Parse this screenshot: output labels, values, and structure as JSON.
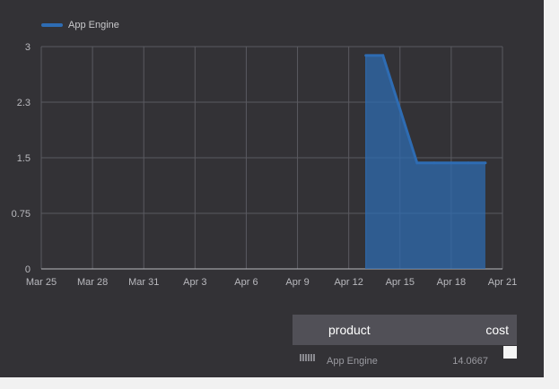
{
  "legend": {
    "series_name": "App Engine",
    "color": "#2e6cb3"
  },
  "chart_data": {
    "type": "area",
    "x_ticks": [
      "Mar 25",
      "Mar 28",
      "Mar 31",
      "Apr 3",
      "Apr 6",
      "Apr 9",
      "Apr 12",
      "Apr 15",
      "Apr 18",
      "Apr 21"
    ],
    "y_ticks": [
      "0",
      "0.75",
      "1.5",
      "2.3",
      "3"
    ],
    "ylim": [
      0,
      3
    ],
    "x_start": "2021-03-25",
    "series": [
      {
        "name": "App Engine",
        "points": [
          {
            "x": "2021-04-13",
            "y": 2.88
          },
          {
            "x": "2021-04-14",
            "y": 2.88
          },
          {
            "x": "2021-04-16",
            "y": 1.43
          },
          {
            "x": "2021-04-17",
            "y": 1.43
          },
          {
            "x": "2021-04-18",
            "y": 1.43
          },
          {
            "x": "2021-04-19",
            "y": 1.43
          },
          {
            "x": "2021-04-20",
            "y": 1.43
          }
        ]
      }
    ],
    "grid": true,
    "legend_position": "top-left"
  },
  "table": {
    "columns": [
      "product",
      "cost"
    ],
    "rows": [
      {
        "product": "App Engine",
        "cost": "14.0667"
      }
    ]
  }
}
